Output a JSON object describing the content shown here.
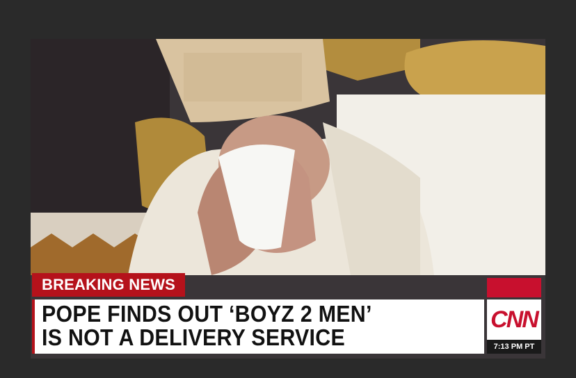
{
  "ticker": {
    "label": "BREAKING NEWS",
    "headline_line1": "POPE FINDS OUT ‘BOYZ 2 MEN’",
    "headline_line2": "IS NOT A DELIVERY SERVICE",
    "network_logo": "CNN",
    "time": "7:13 PM PT"
  },
  "colors": {
    "breaking_red": "#b5121b",
    "cnn_red": "#c8102e"
  }
}
